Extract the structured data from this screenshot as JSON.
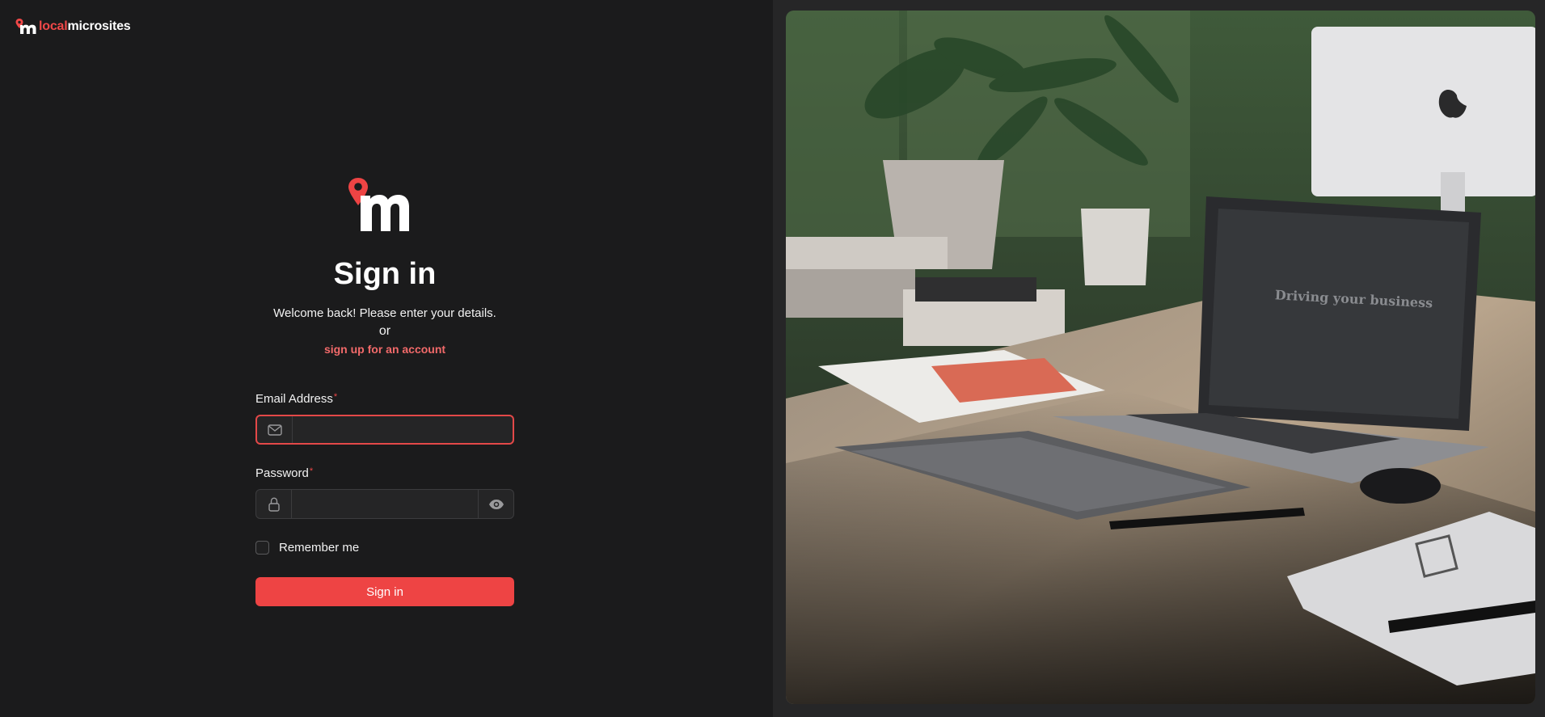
{
  "brand": {
    "local": "local",
    "microsites": "microsites",
    "logo_icon": "map-pin-m-logo",
    "accent_color": "#f04848"
  },
  "signin": {
    "title": "Sign in",
    "welcome": "Welcome back! Please enter your details.",
    "or": "or",
    "signup_link": "sign up for an account"
  },
  "form": {
    "email_label": "Email Address",
    "email_value": "",
    "email_icon": "mail-icon",
    "required_mark": "*",
    "password_label": "Password",
    "password_value": "",
    "password_icon": "lock-icon",
    "toggle_icon": "eye-icon",
    "remember_label": "Remember me",
    "remember_checked": false,
    "submit_label": "Sign in"
  },
  "photo": {
    "screen_text": "Driving your business"
  }
}
